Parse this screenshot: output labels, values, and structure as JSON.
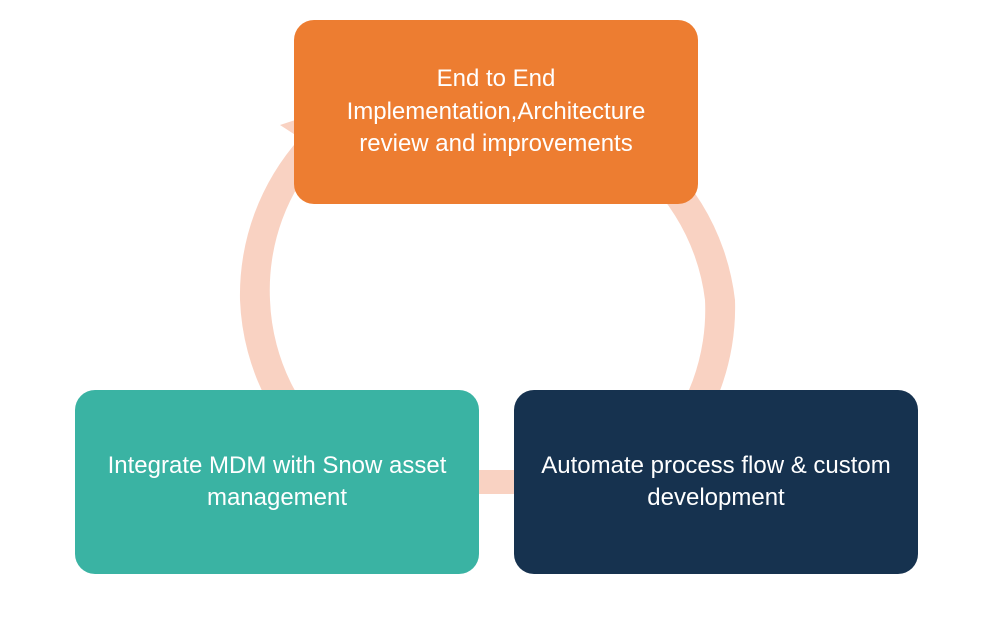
{
  "diagram": {
    "nodes": {
      "top": {
        "text": "End to End Implementation,Architecture review and improvements",
        "color": "#ED7D31"
      },
      "bottom_left": {
        "text": "Integrate  MDM with Snow asset management",
        "color": "#3AB3A3"
      },
      "bottom_right": {
        "text": "Automate process flow & custom development",
        "color": "#16324F"
      }
    },
    "arrow_color": "#F9D2C2",
    "cycle_direction": "clockwise"
  }
}
